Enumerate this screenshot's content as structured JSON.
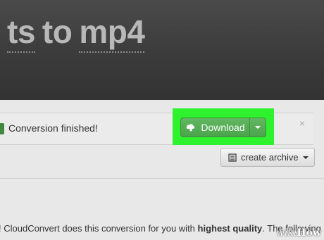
{
  "page": {
    "title_from": "ts",
    "title_sep": "to",
    "title_to": "mp4"
  },
  "status": {
    "message": "Conversion finished!",
    "close_glyph": "×"
  },
  "download": {
    "label": "Download",
    "icon": "cloud-download-icon"
  },
  "archive": {
    "label": "create archive",
    "icon": "archive-icon"
  },
  "description": {
    "prefix": "! CloudConvert does this conversion for you with ",
    "emphasis": "highest quality",
    "suffix": ". The following"
  },
  "watermark": {
    "wiki": "wiki",
    "how": "How"
  },
  "colors": {
    "highlight": "#2ef22e",
    "button_green": "#4ba44b",
    "header_bg": "#3c3c3c"
  }
}
